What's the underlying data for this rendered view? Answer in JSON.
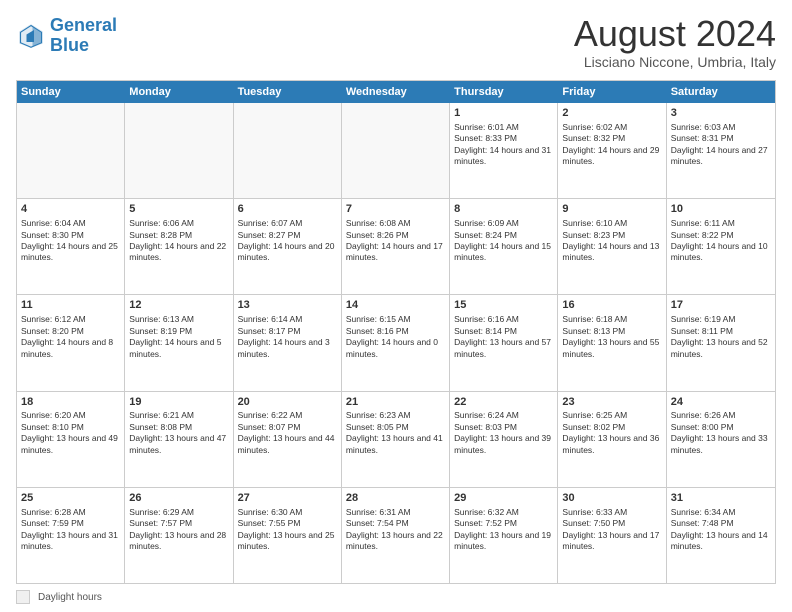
{
  "logo": {
    "line1": "General",
    "line2": "Blue"
  },
  "title": "August 2024",
  "subtitle": "Lisciano Niccone, Umbria, Italy",
  "days_of_week": [
    "Sunday",
    "Monday",
    "Tuesday",
    "Wednesday",
    "Thursday",
    "Friday",
    "Saturday"
  ],
  "footer": {
    "label": "Daylight hours"
  },
  "weeks": [
    [
      {
        "day": "",
        "empty": true
      },
      {
        "day": "",
        "empty": true
      },
      {
        "day": "",
        "empty": true
      },
      {
        "day": "",
        "empty": true
      },
      {
        "day": "1",
        "sunrise": "Sunrise: 6:01 AM",
        "sunset": "Sunset: 8:33 PM",
        "daylight": "Daylight: 14 hours and 31 minutes."
      },
      {
        "day": "2",
        "sunrise": "Sunrise: 6:02 AM",
        "sunset": "Sunset: 8:32 PM",
        "daylight": "Daylight: 14 hours and 29 minutes."
      },
      {
        "day": "3",
        "sunrise": "Sunrise: 6:03 AM",
        "sunset": "Sunset: 8:31 PM",
        "daylight": "Daylight: 14 hours and 27 minutes."
      }
    ],
    [
      {
        "day": "4",
        "sunrise": "Sunrise: 6:04 AM",
        "sunset": "Sunset: 8:30 PM",
        "daylight": "Daylight: 14 hours and 25 minutes."
      },
      {
        "day": "5",
        "sunrise": "Sunrise: 6:06 AM",
        "sunset": "Sunset: 8:28 PM",
        "daylight": "Daylight: 14 hours and 22 minutes."
      },
      {
        "day": "6",
        "sunrise": "Sunrise: 6:07 AM",
        "sunset": "Sunset: 8:27 PM",
        "daylight": "Daylight: 14 hours and 20 minutes."
      },
      {
        "day": "7",
        "sunrise": "Sunrise: 6:08 AM",
        "sunset": "Sunset: 8:26 PM",
        "daylight": "Daylight: 14 hours and 17 minutes."
      },
      {
        "day": "8",
        "sunrise": "Sunrise: 6:09 AM",
        "sunset": "Sunset: 8:24 PM",
        "daylight": "Daylight: 14 hours and 15 minutes."
      },
      {
        "day": "9",
        "sunrise": "Sunrise: 6:10 AM",
        "sunset": "Sunset: 8:23 PM",
        "daylight": "Daylight: 14 hours and 13 minutes."
      },
      {
        "day": "10",
        "sunrise": "Sunrise: 6:11 AM",
        "sunset": "Sunset: 8:22 PM",
        "daylight": "Daylight: 14 hours and 10 minutes."
      }
    ],
    [
      {
        "day": "11",
        "sunrise": "Sunrise: 6:12 AM",
        "sunset": "Sunset: 8:20 PM",
        "daylight": "Daylight: 14 hours and 8 minutes."
      },
      {
        "day": "12",
        "sunrise": "Sunrise: 6:13 AM",
        "sunset": "Sunset: 8:19 PM",
        "daylight": "Daylight: 14 hours and 5 minutes."
      },
      {
        "day": "13",
        "sunrise": "Sunrise: 6:14 AM",
        "sunset": "Sunset: 8:17 PM",
        "daylight": "Daylight: 14 hours and 3 minutes."
      },
      {
        "day": "14",
        "sunrise": "Sunrise: 6:15 AM",
        "sunset": "Sunset: 8:16 PM",
        "daylight": "Daylight: 14 hours and 0 minutes."
      },
      {
        "day": "15",
        "sunrise": "Sunrise: 6:16 AM",
        "sunset": "Sunset: 8:14 PM",
        "daylight": "Daylight: 13 hours and 57 minutes."
      },
      {
        "day": "16",
        "sunrise": "Sunrise: 6:18 AM",
        "sunset": "Sunset: 8:13 PM",
        "daylight": "Daylight: 13 hours and 55 minutes."
      },
      {
        "day": "17",
        "sunrise": "Sunrise: 6:19 AM",
        "sunset": "Sunset: 8:11 PM",
        "daylight": "Daylight: 13 hours and 52 minutes."
      }
    ],
    [
      {
        "day": "18",
        "sunrise": "Sunrise: 6:20 AM",
        "sunset": "Sunset: 8:10 PM",
        "daylight": "Daylight: 13 hours and 49 minutes."
      },
      {
        "day": "19",
        "sunrise": "Sunrise: 6:21 AM",
        "sunset": "Sunset: 8:08 PM",
        "daylight": "Daylight: 13 hours and 47 minutes."
      },
      {
        "day": "20",
        "sunrise": "Sunrise: 6:22 AM",
        "sunset": "Sunset: 8:07 PM",
        "daylight": "Daylight: 13 hours and 44 minutes."
      },
      {
        "day": "21",
        "sunrise": "Sunrise: 6:23 AM",
        "sunset": "Sunset: 8:05 PM",
        "daylight": "Daylight: 13 hours and 41 minutes."
      },
      {
        "day": "22",
        "sunrise": "Sunrise: 6:24 AM",
        "sunset": "Sunset: 8:03 PM",
        "daylight": "Daylight: 13 hours and 39 minutes."
      },
      {
        "day": "23",
        "sunrise": "Sunrise: 6:25 AM",
        "sunset": "Sunset: 8:02 PM",
        "daylight": "Daylight: 13 hours and 36 minutes."
      },
      {
        "day": "24",
        "sunrise": "Sunrise: 6:26 AM",
        "sunset": "Sunset: 8:00 PM",
        "daylight": "Daylight: 13 hours and 33 minutes."
      }
    ],
    [
      {
        "day": "25",
        "sunrise": "Sunrise: 6:28 AM",
        "sunset": "Sunset: 7:59 PM",
        "daylight": "Daylight: 13 hours and 31 minutes."
      },
      {
        "day": "26",
        "sunrise": "Sunrise: 6:29 AM",
        "sunset": "Sunset: 7:57 PM",
        "daylight": "Daylight: 13 hours and 28 minutes."
      },
      {
        "day": "27",
        "sunrise": "Sunrise: 6:30 AM",
        "sunset": "Sunset: 7:55 PM",
        "daylight": "Daylight: 13 hours and 25 minutes."
      },
      {
        "day": "28",
        "sunrise": "Sunrise: 6:31 AM",
        "sunset": "Sunset: 7:54 PM",
        "daylight": "Daylight: 13 hours and 22 minutes."
      },
      {
        "day": "29",
        "sunrise": "Sunrise: 6:32 AM",
        "sunset": "Sunset: 7:52 PM",
        "daylight": "Daylight: 13 hours and 19 minutes."
      },
      {
        "day": "30",
        "sunrise": "Sunrise: 6:33 AM",
        "sunset": "Sunset: 7:50 PM",
        "daylight": "Daylight: 13 hours and 17 minutes."
      },
      {
        "day": "31",
        "sunrise": "Sunrise: 6:34 AM",
        "sunset": "Sunset: 7:48 PM",
        "daylight": "Daylight: 13 hours and 14 minutes."
      }
    ]
  ]
}
